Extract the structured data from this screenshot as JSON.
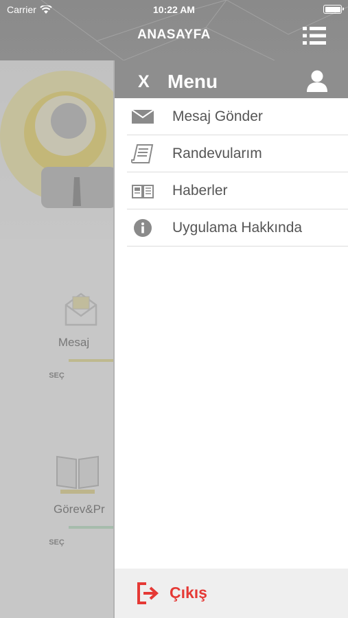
{
  "status": {
    "carrier": "Carrier",
    "time": "10:22 AM"
  },
  "header": {
    "title": "ANASAYFA"
  },
  "background": {
    "tiles": [
      {
        "label": "Mesaj",
        "action": "SEÇ",
        "color": "#e8dc7a"
      },
      {
        "label": "Görev&Pr",
        "action": "SEÇ",
        "color": "#a8d8b8"
      }
    ]
  },
  "drawer": {
    "close": "X",
    "title": "Menu",
    "items": [
      {
        "label": "Mesaj Gönder",
        "icon": "envelope-icon"
      },
      {
        "label": "Randevularım",
        "icon": "scroll-icon"
      },
      {
        "label": "Haberler",
        "icon": "newspaper-icon"
      },
      {
        "label": "Uygulama Hakkında",
        "icon": "info-icon"
      }
    ],
    "logout": "Çıkış"
  },
  "colors": {
    "header": "#8e8e8e",
    "logout": "#e53935",
    "text": "#555555"
  }
}
